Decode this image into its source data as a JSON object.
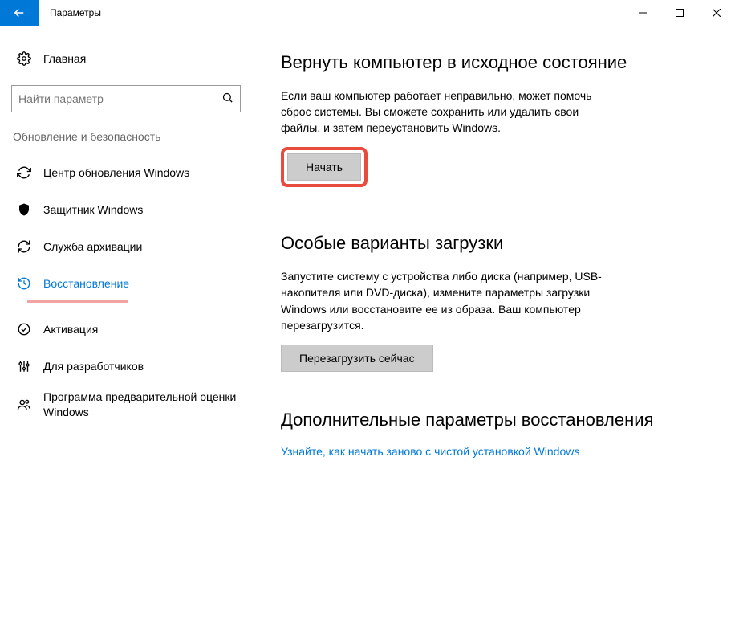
{
  "titlebar": {
    "title": "Параметры"
  },
  "sidebar": {
    "home_label": "Главная",
    "search_placeholder": "Найти параметр",
    "category_header": "Обновление и безопасность",
    "items": [
      {
        "label": "Центр обновления Windows"
      },
      {
        "label": "Защитник Windows"
      },
      {
        "label": "Служба архивации"
      },
      {
        "label": "Восстановление"
      },
      {
        "label": "Активация"
      },
      {
        "label": "Для разработчиков"
      },
      {
        "label": "Программа предварительной оценки Windows"
      }
    ]
  },
  "main": {
    "reset": {
      "heading": "Вернуть компьютер в исходное состояние",
      "text": "Если ваш компьютер работает неправильно, может помочь сброс системы. Вы сможете сохранить или удалить свои файлы, и затем переустановить Windows.",
      "button": "Начать"
    },
    "advanced_startup": {
      "heading": "Особые варианты загрузки",
      "text": "Запустите систему с устройства либо диска (например, USB-накопителя или DVD-диска), измените параметры загрузки Windows или восстановите ее из образа. Ваш компьютер перезагрузится.",
      "button": "Перезагрузить сейчас"
    },
    "more_recovery": {
      "heading": "Дополнительные параметры восстановления",
      "link": "Узнайте, как начать заново с чистой установкой Windows"
    }
  }
}
